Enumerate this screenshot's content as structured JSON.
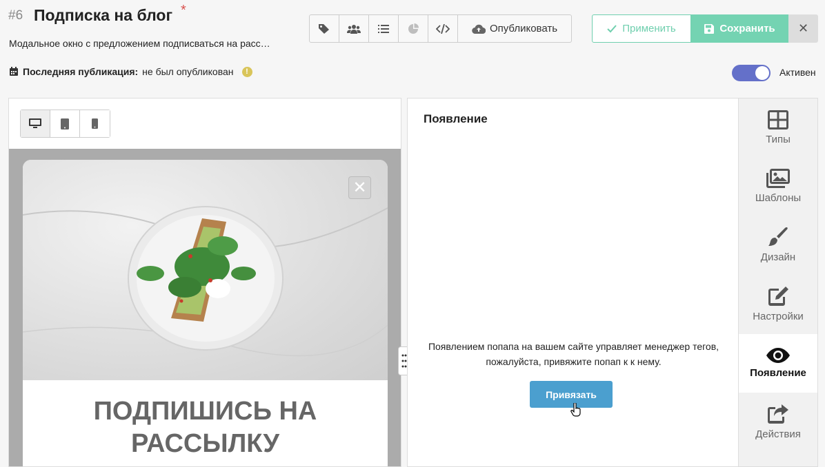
{
  "header": {
    "id": "#6",
    "title": "Подписка на блог",
    "required_mark": "*",
    "subtitle": "Модальное окно с предложением подписваться на расс…",
    "last_pub_label": "Последняя публикация:",
    "last_pub_value": "не был опубликован",
    "warn_icon": "!"
  },
  "toolbar": {
    "publish_label": "Опубликовать",
    "icons": [
      "tags-icon",
      "users-icon",
      "list-icon",
      "pie-chart-icon",
      "code-icon"
    ],
    "pie_chart_disabled": true
  },
  "actions": {
    "apply_label": "Применить",
    "save_label": "Сохранить",
    "close_label": "✕"
  },
  "status": {
    "active_label": "Активен",
    "active": true
  },
  "preview": {
    "devices": [
      "desktop-icon",
      "tablet-icon",
      "mobile-icon"
    ],
    "active_device": "desktop",
    "close_symbol": "✕",
    "heading_line1": "ПОДПИШИСЬ НА",
    "heading_line2": "РАССЫЛКУ"
  },
  "appearance": {
    "title": "Появление",
    "info_line1": "Появлением попапа на вашем сайте управляет менеджер тегов,",
    "info_line2": "пожалуйста, привяжите попап к к нему.",
    "bind_button": "Привязать"
  },
  "sidebar": {
    "items": [
      {
        "label": "Типы",
        "icon": "grid-icon"
      },
      {
        "label": "Шаблоны",
        "icon": "images-icon"
      },
      {
        "label": "Дизайн",
        "icon": "brush-icon"
      },
      {
        "label": "Настройки",
        "icon": "edit-icon"
      },
      {
        "label": "Появление",
        "icon": "eye-icon",
        "active": true
      },
      {
        "label": "Действия",
        "icon": "share-icon"
      }
    ]
  },
  "colors": {
    "accent_green": "#74d3b2",
    "toggle": "#6470c9",
    "bind_button": "#4b9fcf"
  }
}
